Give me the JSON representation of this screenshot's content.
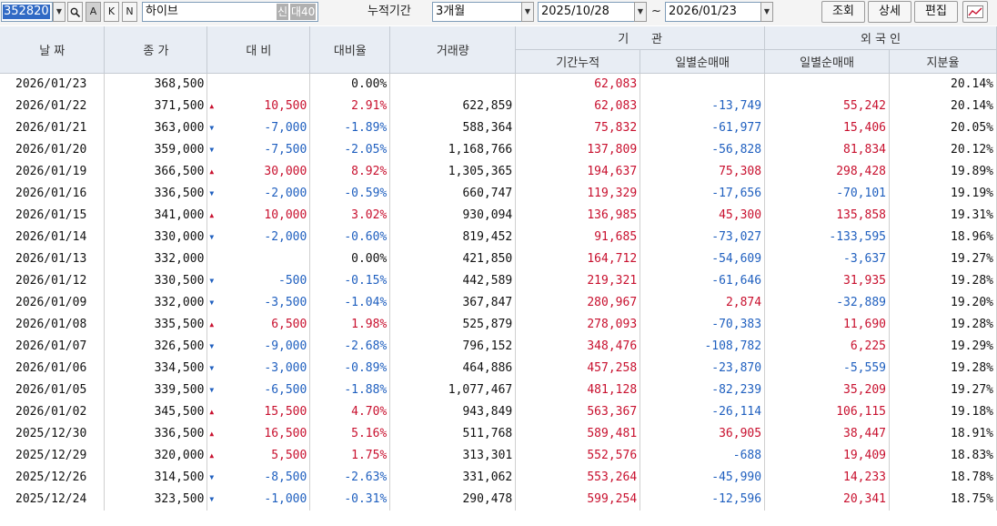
{
  "toolbar": {
    "stock_code": "352820",
    "stock_name": "하이브",
    "badge_new": "신",
    "badge_margin": "대40",
    "search_icon": "magnifier-icon",
    "btn_a": "A",
    "btn_k": "K",
    "btn_n": "N",
    "period_label": "누적기간",
    "period_value": "3개월",
    "date_from": "2025/10/28",
    "tilde": "~",
    "date_to": "2026/01/23",
    "query_label": "조회",
    "detail_label": "상세",
    "edit_label": "편집",
    "chart_icon": "line-chart-icon"
  },
  "headers": {
    "date": "날 짜",
    "close": "종 가",
    "change": "대 비",
    "rate": "대비율",
    "volume": "거래량",
    "institution": "기      관",
    "inst_cum": "기간누적",
    "inst_daily": "일별순매매",
    "foreign": "외 국 인",
    "foreign_daily": "일별순매매",
    "foreign_share": "지분율"
  },
  "colors": {
    "up": "#c8102e",
    "down": "#1f5fbf",
    "header_bg": "#e8edf4",
    "selection": "#316ac5"
  },
  "rows": [
    [
      "2026/01/23",
      "368,500",
      "flat",
      "",
      "0.00%",
      "",
      "62,083",
      "",
      "",
      "20.14%"
    ],
    [
      "2026/01/22",
      "371,500",
      "up",
      "10,500",
      "2.91%",
      "622,859",
      "62,083",
      "-13,749",
      "55,242",
      "20.14%"
    ],
    [
      "2026/01/21",
      "363,000",
      "down",
      "-7,000",
      "-1.89%",
      "588,364",
      "75,832",
      "-61,977",
      "15,406",
      "20.05%"
    ],
    [
      "2026/01/20",
      "359,000",
      "down",
      "-7,500",
      "-2.05%",
      "1,168,766",
      "137,809",
      "-56,828",
      "81,834",
      "20.12%"
    ],
    [
      "2026/01/19",
      "366,500",
      "up",
      "30,000",
      "8.92%",
      "1,305,365",
      "194,637",
      "75,308",
      "298,428",
      "19.89%"
    ],
    [
      "2026/01/16",
      "336,500",
      "down",
      "-2,000",
      "-0.59%",
      "660,747",
      "119,329",
      "-17,656",
      "-70,101",
      "19.19%"
    ],
    [
      "2026/01/15",
      "341,000",
      "up",
      "10,000",
      "3.02%",
      "930,094",
      "136,985",
      "45,300",
      "135,858",
      "19.31%"
    ],
    [
      "2026/01/14",
      "330,000",
      "down",
      "-2,000",
      "-0.60%",
      "819,452",
      "91,685",
      "-73,027",
      "-133,595",
      "18.96%"
    ],
    [
      "2026/01/13",
      "332,000",
      "flat",
      "",
      "0.00%",
      "421,850",
      "164,712",
      "-54,609",
      "-3,637",
      "19.27%"
    ],
    [
      "2026/01/12",
      "330,500",
      "down",
      "-500",
      "-0.15%",
      "442,589",
      "219,321",
      "-61,646",
      "31,935",
      "19.28%"
    ],
    [
      "2026/01/09",
      "332,000",
      "down",
      "-3,500",
      "-1.04%",
      "367,847",
      "280,967",
      "2,874",
      "-32,889",
      "19.20%"
    ],
    [
      "2026/01/08",
      "335,500",
      "up",
      "6,500",
      "1.98%",
      "525,879",
      "278,093",
      "-70,383",
      "11,690",
      "19.28%"
    ],
    [
      "2026/01/07",
      "326,500",
      "down",
      "-9,000",
      "-2.68%",
      "796,152",
      "348,476",
      "-108,782",
      "6,225",
      "19.29%"
    ],
    [
      "2026/01/06",
      "334,500",
      "down",
      "-3,000",
      "-0.89%",
      "464,886",
      "457,258",
      "-23,870",
      "-5,559",
      "19.28%"
    ],
    [
      "2026/01/05",
      "339,500",
      "down",
      "-6,500",
      "-1.88%",
      "1,077,467",
      "481,128",
      "-82,239",
      "35,209",
      "19.27%"
    ],
    [
      "2026/01/02",
      "345,500",
      "up",
      "15,500",
      "4.70%",
      "943,849",
      "563,367",
      "-26,114",
      "106,115",
      "19.18%"
    ],
    [
      "2025/12/30",
      "336,500",
      "up",
      "16,500",
      "5.16%",
      "511,768",
      "589,481",
      "36,905",
      "38,447",
      "18.91%"
    ],
    [
      "2025/12/29",
      "320,000",
      "up",
      "5,500",
      "1.75%",
      "313,301",
      "552,576",
      "-688",
      "19,409",
      "18.83%"
    ],
    [
      "2025/12/26",
      "314,500",
      "down",
      "-8,500",
      "-2.63%",
      "331,062",
      "553,264",
      "-45,990",
      "14,233",
      "18.78%"
    ],
    [
      "2025/12/24",
      "323,500",
      "down",
      "-1,000",
      "-0.31%",
      "290,478",
      "599,254",
      "-12,596",
      "20,341",
      "18.75%"
    ]
  ]
}
